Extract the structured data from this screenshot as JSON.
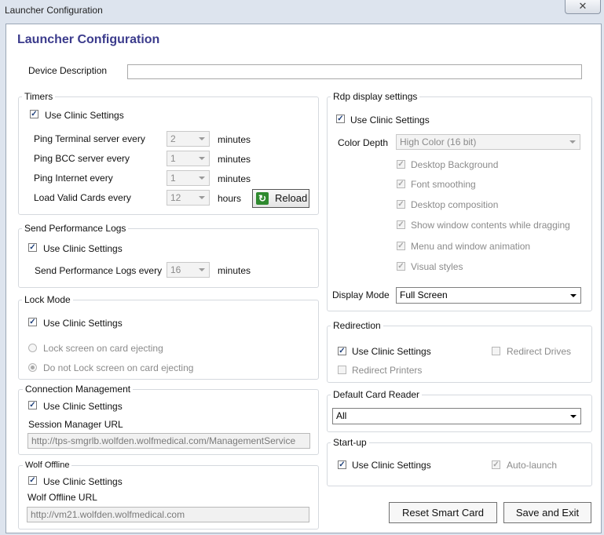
{
  "window": {
    "title": "Launcher Configuration",
    "close_glyph": "✕"
  },
  "heading": "Launcher Configuration",
  "device": {
    "label": "Device Description",
    "value": ""
  },
  "timers": {
    "legend": "Timers",
    "use_clinic": "Use Clinic Settings",
    "rows": [
      {
        "label": "Ping Terminal server every",
        "value": "2",
        "unit": "minutes"
      },
      {
        "label": "Ping BCC server every",
        "value": "1",
        "unit": "minutes"
      },
      {
        "label": "Ping Internet every",
        "value": "1",
        "unit": "minutes"
      },
      {
        "label": "Load Valid Cards every",
        "value": "12",
        "unit": "hours"
      }
    ],
    "reload_label": "Reload"
  },
  "perf_logs": {
    "legend": "Send Performance Logs",
    "use_clinic": "Use Clinic Settings",
    "label": "Send Performance Logs every",
    "value": "16",
    "unit": "minutes"
  },
  "lock_mode": {
    "legend": "Lock Mode",
    "use_clinic": "Use Clinic Settings",
    "option1": "Lock screen on card ejecting",
    "option2": "Do not Lock screen on card ejecting"
  },
  "connection": {
    "legend": "Connection Management",
    "use_clinic": "Use Clinic Settings",
    "url_label": "Session Manager URL",
    "url_value": "http://tps-smgrlb.wolfden.wolfmedical.com/ManagementService"
  },
  "wolf_offline": {
    "legend": "Wolf Offline",
    "use_clinic": "Use Clinic Settings",
    "url_label": "Wolf Offline URL",
    "url_value": "http://vm21.wolfden.wolfmedical.com"
  },
  "rdp": {
    "legend": "Rdp display settings",
    "use_clinic": "Use Clinic Settings",
    "color_depth_label": "Color Depth",
    "color_depth_value": "High Color (16 bit)",
    "options": [
      "Desktop Background",
      "Font smoothing",
      "Desktop composition",
      "Show window contents while dragging",
      "Menu and window animation",
      "Visual styles"
    ],
    "display_mode_label": "Display Mode",
    "display_mode_value": "Full Screen"
  },
  "redirection": {
    "legend": "Redirection",
    "use_clinic": "Use Clinic Settings",
    "drives": "Redirect Drives",
    "printers": "Redirect Printers"
  },
  "card_reader": {
    "legend": "Default Card Reader",
    "value": "All"
  },
  "startup": {
    "legend": "Start-up",
    "use_clinic": "Use Clinic Settings",
    "auto_launch": "Auto-launch"
  },
  "buttons": {
    "reset": "Reset Smart Card",
    "save": "Save and Exit"
  },
  "check_glyph": "✓"
}
